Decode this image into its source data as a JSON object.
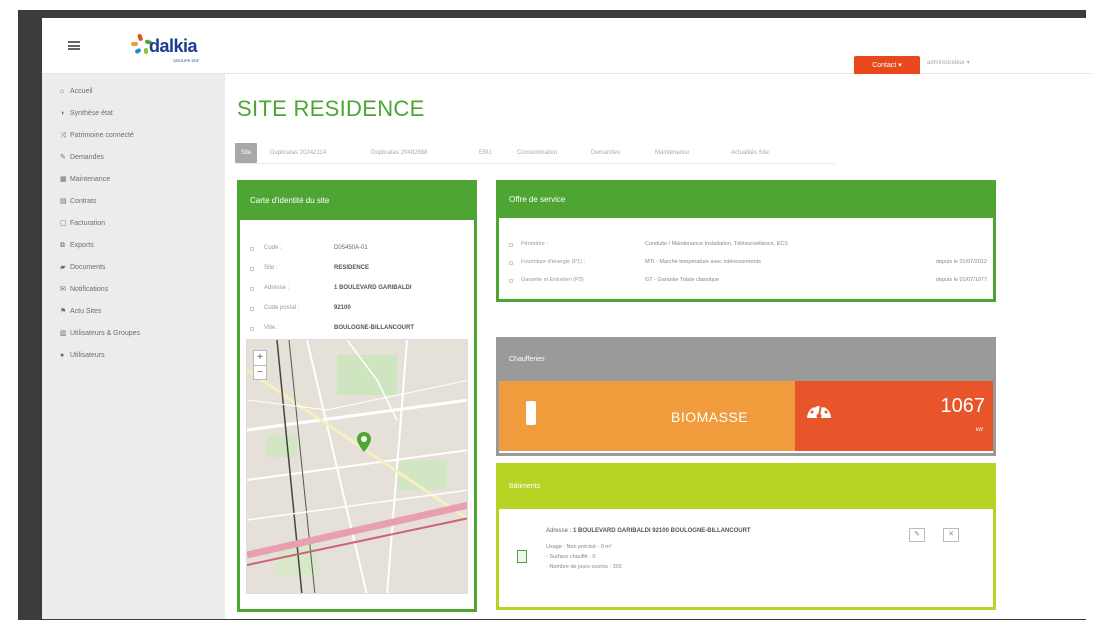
{
  "header": {
    "logo_text": "dalkia",
    "logo_subtext": "GROUPE EDF",
    "contact_label": "Contact",
    "user_label": "administrateur"
  },
  "sidebar": {
    "items": [
      {
        "label": "Accueil",
        "icon": "home-icon",
        "glyph": "⌂"
      },
      {
        "label": "Synthèse état",
        "icon": "pie-icon",
        "glyph": "◑"
      },
      {
        "label": "Patrimoine connecté",
        "icon": "shuffle-icon",
        "glyph": "⤨"
      },
      {
        "label": "Demandes",
        "icon": "request-icon",
        "glyph": "✎"
      },
      {
        "label": "Maintenance",
        "icon": "calendar-icon",
        "glyph": "▦"
      },
      {
        "label": "Contrats",
        "icon": "document-icon",
        "glyph": "▤"
      },
      {
        "label": "Facturation",
        "icon": "invoice-icon",
        "glyph": "▢"
      },
      {
        "label": "Exports",
        "icon": "export-icon",
        "glyph": "⧉"
      },
      {
        "label": "Documents",
        "icon": "folder-icon",
        "glyph": "▰"
      },
      {
        "label": "Notifications",
        "icon": "mail-icon",
        "glyph": "✉"
      },
      {
        "label": "Actu Sites",
        "icon": "news-icon",
        "glyph": "⚑"
      },
      {
        "label": "Utilisateurs & Groupes",
        "icon": "users-icon",
        "glyph": "▥"
      },
      {
        "label": "Utilisateurs",
        "icon": "user-icon",
        "glyph": "●"
      }
    ]
  },
  "page": {
    "title": "SITE RESIDENCE",
    "tabs": [
      {
        "label": "Site"
      },
      {
        "label": "Duplicatas 2024211A"
      },
      {
        "label": "Duplicatas 20482888"
      },
      {
        "label": "EBU"
      },
      {
        "label": "Consommation"
      },
      {
        "label": "Demandes"
      },
      {
        "label": "Maintenance"
      },
      {
        "label": "Actualités Site"
      }
    ]
  },
  "identity_card": {
    "title": "Carte d'identité du site",
    "fields": [
      {
        "label": "Code :",
        "value": "D05450A-01"
      },
      {
        "label": "Site :",
        "value": "RESIDENCE"
      },
      {
        "label": "Adresse :",
        "value": "1 BOULEVARD GARIBALDI"
      },
      {
        "label": "Code postal :",
        "value": "92100"
      },
      {
        "label": "Ville :",
        "value": "BOULOGNE-BILLANCOURT"
      }
    ]
  },
  "service_offer": {
    "title": "Offre de service",
    "rows": [
      {
        "label": "Périmètre :",
        "value": "Conduite / Maintenance Installation, Télésurveillance, ECS",
        "date": ""
      },
      {
        "label": "Fourniture d'énergie (P1) :",
        "value": "MTI - Marché température avec intéressements",
        "date": "depuis le 01/07/2012"
      },
      {
        "label": "Garantie et Entretien (P3) :",
        "value": "GT - Garantie Totale classique",
        "date": "depuis le 01/07/1977"
      }
    ]
  },
  "boilers": {
    "title": "Chaufferies",
    "energy": "BIOMASSE",
    "power": "1067",
    "unit": "kW"
  },
  "buildings": {
    "title": "Bâtiments",
    "address_label": "Adresse :",
    "address_value": "1 BOULEVARD GARIBALDI 92100 BOULOGNE-BILLANCOURT",
    "usage": "Usage : Non précisé - 0 m²",
    "heated_surface": "- Surface chauffé : 0",
    "days_open": "- Nombre de jours ouvrés : 302"
  },
  "colors": {
    "green": "#4ea533",
    "lime": "#b8d225",
    "orange": "#f09b3c",
    "red_orange": "#e8552a",
    "grey": "#9a9a9a"
  }
}
